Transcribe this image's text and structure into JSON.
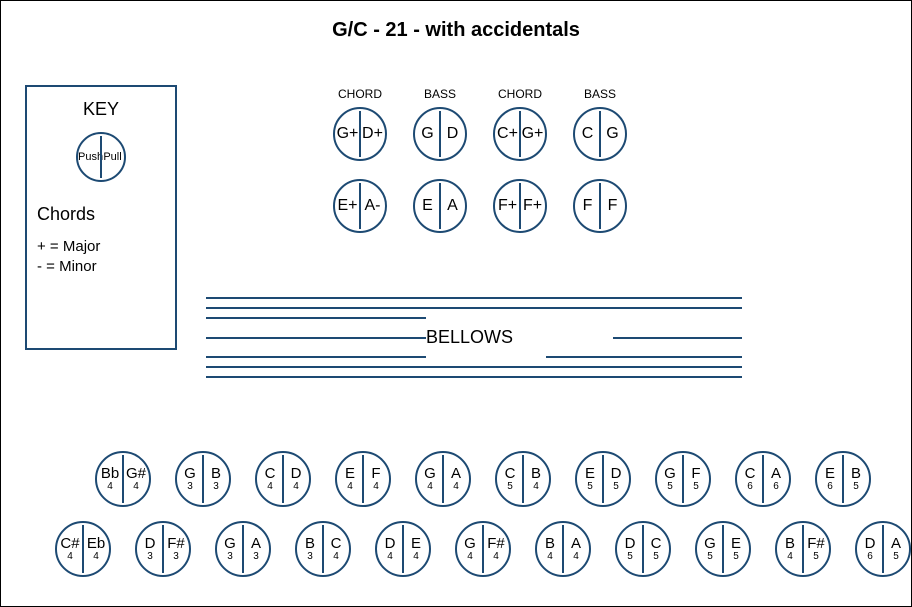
{
  "title": "G/C - 21 - with accidentals",
  "key": {
    "title": "KEY",
    "push": "Push",
    "pull": "Pull",
    "chords_title": "Chords",
    "major": "+ = Major",
    "minor": "-  = Minor"
  },
  "bass": {
    "headers": [
      "CHORD",
      "BASS",
      "CHORD",
      "BASS"
    ],
    "row1": [
      {
        "push": "G+",
        "pull": "D+"
      },
      {
        "push": "G",
        "pull": "D"
      },
      {
        "push": "C+",
        "pull": "G+"
      },
      {
        "push": "C",
        "pull": "G"
      }
    ],
    "row2": [
      {
        "push": "E+",
        "pull": "A-"
      },
      {
        "push": "E",
        "pull": "A"
      },
      {
        "push": "F+",
        "pull": "F+"
      },
      {
        "push": "F",
        "pull": "F"
      }
    ]
  },
  "bellows_label": "BELLOWS",
  "treble": {
    "row1": [
      {
        "pn": "Bb",
        "po": "4",
        "qn": "G#",
        "qo": "4"
      },
      {
        "pn": "G",
        "po": "3",
        "qn": "B",
        "qo": "3"
      },
      {
        "pn": "C",
        "po": "4",
        "qn": "D",
        "qo": "4"
      },
      {
        "pn": "E",
        "po": "4",
        "qn": "F",
        "qo": "4"
      },
      {
        "pn": "G",
        "po": "4",
        "qn": "A",
        "qo": "4"
      },
      {
        "pn": "C",
        "po": "5",
        "qn": "B",
        "qo": "4"
      },
      {
        "pn": "E",
        "po": "5",
        "qn": "D",
        "qo": "5"
      },
      {
        "pn": "G",
        "po": "5",
        "qn": "F",
        "qo": "5"
      },
      {
        "pn": "C",
        "po": "6",
        "qn": "A",
        "qo": "6"
      },
      {
        "pn": "E",
        "po": "6",
        "qn": "B",
        "qo": "5"
      }
    ],
    "row2": [
      {
        "pn": "C#",
        "po": "4",
        "qn": "Eb",
        "qo": "4"
      },
      {
        "pn": "D",
        "po": "3",
        "qn": "F#",
        "qo": "3"
      },
      {
        "pn": "G",
        "po": "3",
        "qn": "A",
        "qo": "3"
      },
      {
        "pn": "B",
        "po": "3",
        "qn": "C",
        "qo": "4"
      },
      {
        "pn": "D",
        "po": "4",
        "qn": "E",
        "qo": "4"
      },
      {
        "pn": "G",
        "po": "4",
        "qn": "F#",
        "qo": "4"
      },
      {
        "pn": "B",
        "po": "4",
        "qn": "A",
        "qo": "4"
      },
      {
        "pn": "D",
        "po": "5",
        "qn": "C",
        "qo": "5"
      },
      {
        "pn": "G",
        "po": "5",
        "qn": "E",
        "qo": "5"
      },
      {
        "pn": "B",
        "po": "4",
        "qn": "F#",
        "qo": "5"
      },
      {
        "pn": "D",
        "po": "6",
        "qn": "A",
        "qo": "5"
      }
    ]
  }
}
